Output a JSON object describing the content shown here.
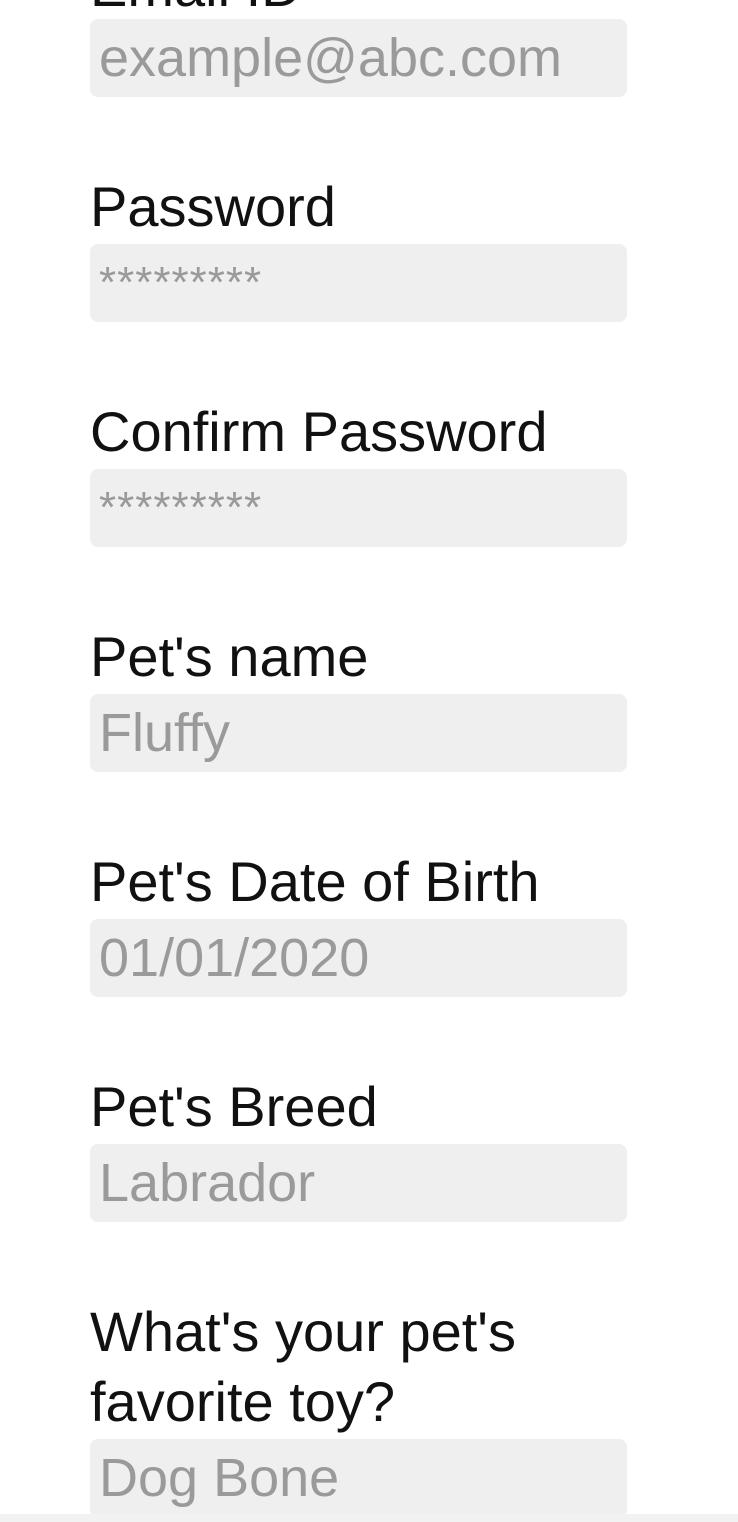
{
  "form": {
    "email": {
      "label": "Email ID",
      "placeholder": "example@abc.com"
    },
    "password": {
      "label": "Password",
      "placeholder": "*********"
    },
    "confirm_password": {
      "label": "Confirm Password",
      "placeholder": "*********"
    },
    "pet_name": {
      "label": "Pet's name",
      "placeholder": "Fluffy"
    },
    "pet_dob": {
      "label": "Pet's Date of Birth",
      "placeholder": "01/01/2020"
    },
    "pet_breed": {
      "label": "Pet's Breed",
      "placeholder": "Labrador"
    },
    "pet_toy": {
      "label": "What's your pet's favorite toy?",
      "placeholder": "Dog Bone"
    }
  }
}
